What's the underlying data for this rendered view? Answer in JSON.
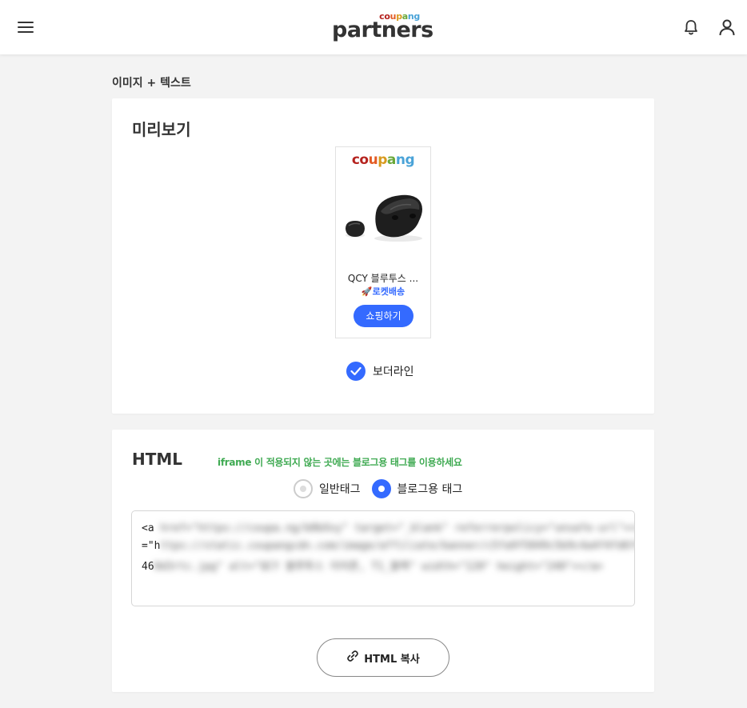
{
  "header": {
    "menu_icon": "hamburger-menu-icon",
    "logo_small": [
      "c",
      "o",
      "u",
      "p",
      "a",
      "n",
      "g"
    ],
    "logo_small_colors": [
      "#b5231f",
      "#b5231f",
      "#e35b24",
      "#d89a1e",
      "#6aa83a",
      "#4aa3d8",
      "#4aa3d8"
    ],
    "logo_main": "partners",
    "bell_icon": "bell-icon",
    "user_icon": "user-icon"
  },
  "page": {
    "label": "이미지 + 텍스트"
  },
  "preview": {
    "title": "미리보기",
    "widget": {
      "logo": [
        "c",
        "o",
        "u",
        "p",
        "a",
        "n",
        "g"
      ],
      "logo_colors": [
        "#b5231f",
        "#b5231f",
        "#e35b24",
        "#d89a1e",
        "#6aa83a",
        "#4aa3d8",
        "#4aa3d8"
      ],
      "product_name": "QCY 블루투스 ...",
      "delivery": "🚀로켓배송",
      "shop_button": "쇼핑하기"
    },
    "border_option": {
      "label": "보더라인",
      "checked": true
    }
  },
  "html_section": {
    "title": "HTML",
    "hint": "iframe 이 적용되지 않는 곳에는 블로그용 태그를 이용하세요",
    "radios": [
      {
        "label": "일반태그",
        "selected": false
      },
      {
        "label": "블로그용 태그",
        "selected": true
      }
    ],
    "code_lines": [
      {
        "visible": "<a",
        "obscured": " href=\"https://coupa.ng/b0bXxy\" target=\"_blank\" referrerpolicy=\"unsafe-url\"><img src"
      },
      {
        "visible": "=\"h",
        "obscured": "ttps://static.coupangcdn.com/image/affiliate/banner/c5fa9f5849c5b9c4a4f4fd6f4f0d2846"
      },
      {
        "visible": "46",
        "obscured": "0d3rtc.jpg\" alt=\"QCY 블루투스 이어폰, T1_블랙\" width=\"120\" height=\"240\"></a>"
      }
    ],
    "copy_button": "HTML 복사",
    "copy_icon": "link-icon"
  },
  "colors": {
    "accent": "#346aff",
    "hint_green": "#3faa52",
    "background": "#f3f3f3"
  }
}
